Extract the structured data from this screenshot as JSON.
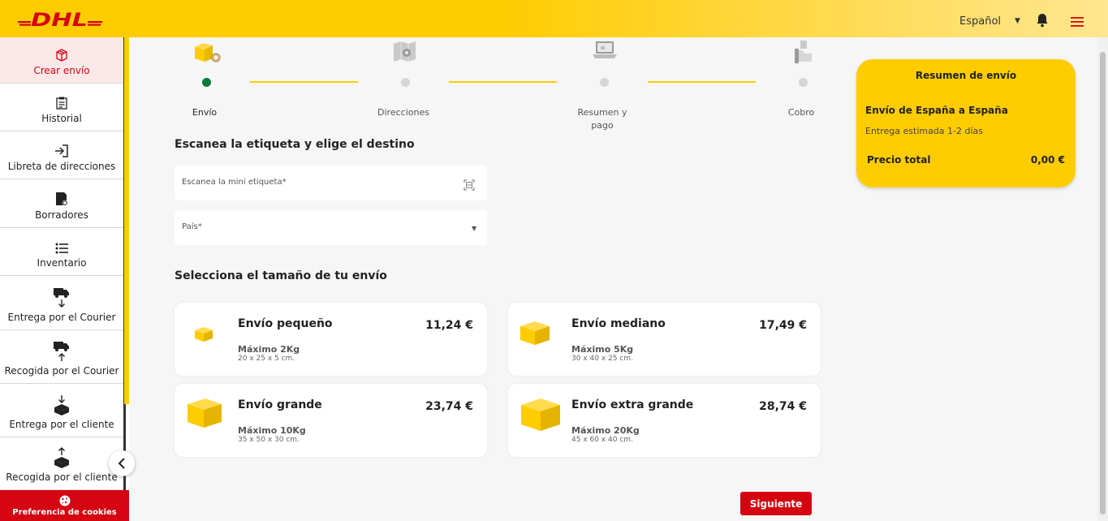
{
  "header": {
    "logo_text": "DHL",
    "language": "Español"
  },
  "sidebar": {
    "items": [
      {
        "label": "Crear envío"
      },
      {
        "label": "Historial"
      },
      {
        "label": "Libreta de direcciones"
      },
      {
        "label": "Borradores"
      },
      {
        "label": "Inventario"
      },
      {
        "label": "Entrega por el Courier"
      },
      {
        "label": "Recogida por el Courier"
      },
      {
        "label": "Entrega por el cliente"
      },
      {
        "label": "Recogida por el cliente"
      }
    ],
    "cookies": "Preferencia de cookies"
  },
  "stepper": {
    "steps": [
      {
        "label": "Envío",
        "active": true
      },
      {
        "label": "Direcciones",
        "active": false
      },
      {
        "label": "Resumen y pago",
        "active": false
      },
      {
        "label": "Cobro",
        "active": false
      }
    ]
  },
  "form": {
    "scan_title": "Escanea la etiqueta y elige el destino",
    "scan_placeholder": "Escanea la mini etiqueta*",
    "country_placeholder": "País*",
    "size_title": "Selecciona el tamaño de tu envío"
  },
  "sizes": [
    {
      "name": "Envío pequeño",
      "price": "11,24 €",
      "max": "Máximo 2Kg",
      "dims": "20 x 25 x 5 cm."
    },
    {
      "name": "Envío mediano",
      "price": "17,49 €",
      "max": "Máximo 5Kg",
      "dims": "30 x 40 x 25 cm."
    },
    {
      "name": "Envío grande",
      "price": "23,74 €",
      "max": "Máximo 10Kg",
      "dims": "35 x 50 x 30 cm."
    },
    {
      "name": "Envío extra grande",
      "price": "28,74 €",
      "max": "Máximo 20Kg",
      "dims": "45 x 60 x 40 cm."
    }
  ],
  "summary": {
    "title": "Resumen de envío",
    "route": "Envío de España a España",
    "eta": "Entrega estimada 1-2 días",
    "total_label": "Precio total",
    "total_value": "0,00 €"
  },
  "actions": {
    "next": "Siguiente"
  },
  "colors": {
    "brand_yellow": "#ffcc00",
    "brand_red": "#d40511",
    "active_step": "#007c39"
  }
}
